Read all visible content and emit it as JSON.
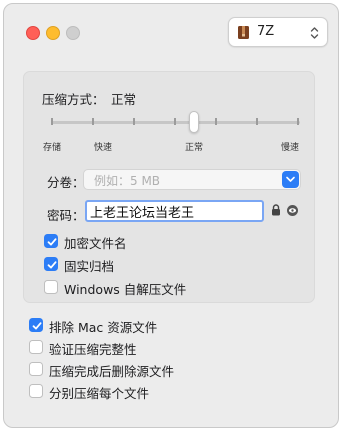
{
  "toolbar": {
    "format": {
      "label": "7Z",
      "icon": "archive-icon"
    }
  },
  "compression": {
    "method_label": "压缩方式：",
    "method_value": "正常",
    "slider": {
      "tick_count": 7,
      "selected_index": 4,
      "labels": [
        "存储",
        "快速",
        "正常",
        "慢速"
      ]
    }
  },
  "split": {
    "label": "分卷：",
    "placeholder": "例如：5 MB"
  },
  "password": {
    "label": "密码：",
    "value": "上老王论坛当老王"
  },
  "panel_options": [
    {
      "label": "加密文件名",
      "checked": true
    },
    {
      "label": "固实归档",
      "checked": true
    },
    {
      "label": "Windows 自解压文件",
      "checked": false
    }
  ],
  "global_options": [
    {
      "label": "排除 Mac 资源文件",
      "checked": true
    },
    {
      "label": "验证压缩完整性",
      "checked": false
    },
    {
      "label": "压缩完成后删除源文件",
      "checked": false
    },
    {
      "label": "分别压缩每个文件",
      "checked": false
    }
  ],
  "colors": {
    "accent": "#2c7df6",
    "window_bg": "#ececec",
    "panel_bg": "#e4e4e4"
  }
}
